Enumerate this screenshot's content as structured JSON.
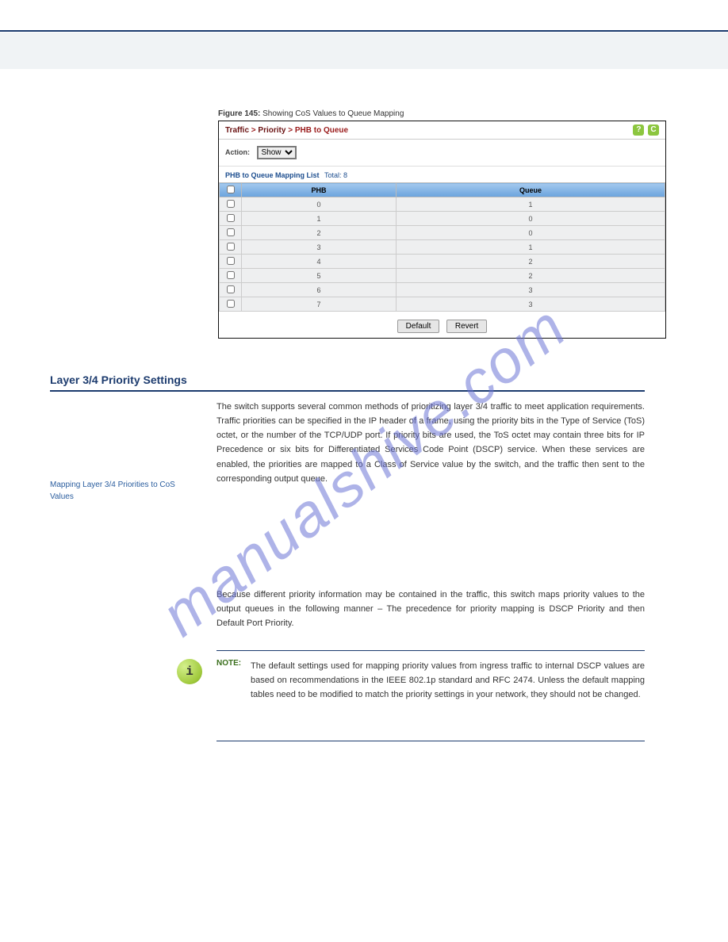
{
  "watermark": "manualshive.com",
  "figure": {
    "number": "Figure 145:",
    "title": "Showing CoS Values to Queue Mapping"
  },
  "screenshot": {
    "breadcrumb": {
      "a": "Traffic",
      "b": "Priority",
      "c": "PHB to Queue"
    },
    "help_icon": "?",
    "refresh_icon": "C",
    "action_label": "Action:",
    "action_value": "Show",
    "list_title": "PHB to Queue Mapping List",
    "total_label": "Total: 8",
    "cols": {
      "chk": "",
      "phb": "PHB",
      "queue": "Queue"
    },
    "rows": [
      {
        "phb": "0",
        "queue": "1"
      },
      {
        "phb": "1",
        "queue": "0"
      },
      {
        "phb": "2",
        "queue": "0"
      },
      {
        "phb": "3",
        "queue": "1"
      },
      {
        "phb": "4",
        "queue": "2"
      },
      {
        "phb": "5",
        "queue": "2"
      },
      {
        "phb": "6",
        "queue": "3"
      },
      {
        "phb": "7",
        "queue": "3"
      }
    ],
    "btn_default": "Default",
    "btn_revert": "Revert"
  },
  "section1_title": "Layer 3/4 Priority Settings",
  "side_label": "Mapping Layer 3/4 Priorities to CoS Values",
  "para1": "The switch supports several common methods of prioritizing layer 3/4 traffic to meet application requirements. Traffic priorities can be specified in the IP header of a frame, using the priority bits in the Type of Service (ToS) octet, or the number of the TCP/UDP port. If priority bits are used, the ToS octet may contain three bits for IP Precedence or six bits for Differentiated Services Code Point (DSCP) service. When these services are enabled, the priorities are mapped to a Class of Service value by the switch, and the traffic then sent to the corresponding output queue.",
  "para2": "Because different priority information may be contained in the traffic, this switch maps priority values to the output queues in the following manner – The precedence for priority mapping is DSCP Priority and then Default Port Priority.",
  "note_label": "NOTE:",
  "note_text": "The default settings used for mapping priority values from ingress traffic to internal DSCP values are based on recommendations in the IEEE 802.1p standard and RFC 2474. Unless the default mapping tables need to be modified to match the priority settings in your network, they should not be changed."
}
